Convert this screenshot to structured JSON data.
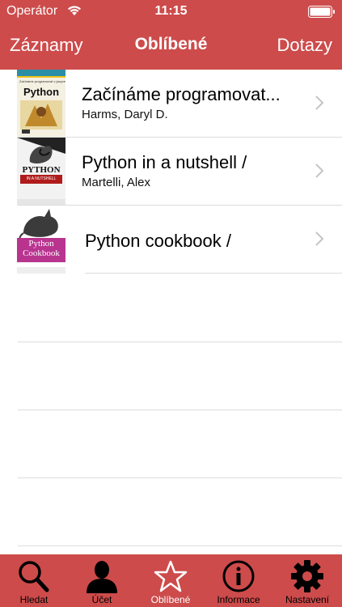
{
  "status": {
    "carrier": "Operátor",
    "time": "11:15"
  },
  "nav": {
    "left": "Záznamy",
    "title": "Oblíbené",
    "right": "Dotazy"
  },
  "books": [
    {
      "title": "Začínáme programovat...",
      "author": "Harms, Daryl D.",
      "cover_title": "Python",
      "cover_subtitle": "Začínáme programovat v jazyce"
    },
    {
      "title": "Python in a nutshell /",
      "author": "Martelli, Alex",
      "cover_title": "PYTHON",
      "cover_subtitle": "IN A NUTSHELL"
    },
    {
      "title": "Python cookbook /",
      "author": "",
      "cover_title": "Python",
      "cover_subtitle": "Cookbook"
    }
  ],
  "tabs": [
    {
      "label": "Hledat",
      "icon": "search-icon"
    },
    {
      "label": "Účet",
      "icon": "person-icon"
    },
    {
      "label": "Oblíbené",
      "icon": "star-icon",
      "active": true
    },
    {
      "label": "Informace",
      "icon": "info-icon"
    },
    {
      "label": "Nastavení",
      "icon": "gear-icon"
    }
  ],
  "colors": {
    "accent": "#cd4b4b",
    "separator": "#dcdcdc",
    "active_tab_text": "#ffffff"
  }
}
